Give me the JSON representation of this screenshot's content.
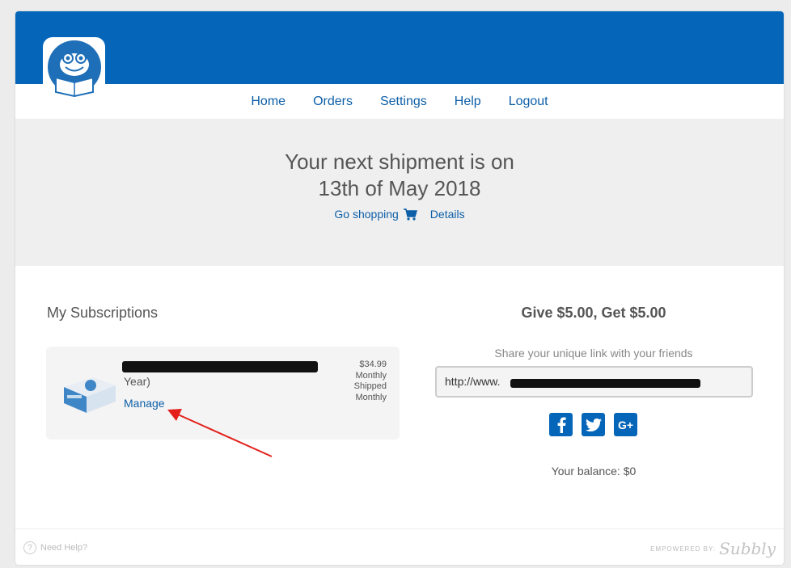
{
  "nav": {
    "items": [
      "Home",
      "Orders",
      "Settings",
      "Help",
      "Logout"
    ]
  },
  "hero": {
    "line1": "Your next shipment is on",
    "line2": "13th of May 2018",
    "go_shopping": "Go shopping",
    "details": "Details"
  },
  "subscriptions": {
    "title": "My Subscriptions",
    "item": {
      "name_visible": "Year)",
      "manage_label": "Manage",
      "price": "$34.99",
      "frequency": "Monthly",
      "shipped_label": "Shipped",
      "shipped_frequency": "Monthly"
    }
  },
  "referral": {
    "title": "Give $5.00, Get $5.00",
    "share_label": "Share your unique link with your friends",
    "url_prefix": "http://www.",
    "social": [
      "facebook-icon",
      "twitter-icon",
      "google-plus-icon"
    ],
    "balance": "Your balance: $0"
  },
  "footer": {
    "help": "Need Help?",
    "empowered": "EMPOWERED BY:",
    "brand": "Subbly"
  },
  "colors": {
    "brand_blue": "#0566b9",
    "link": "#0d5fa8",
    "annotation_arrow": "#e3201b"
  }
}
